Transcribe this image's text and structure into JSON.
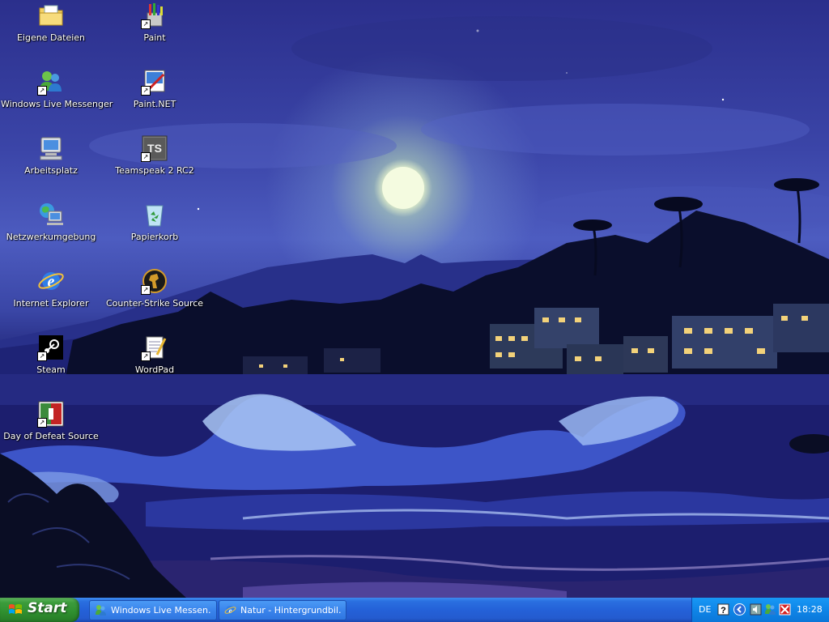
{
  "desktop": {
    "icons": [
      {
        "label": "Eigene Dateien",
        "icon": "folder-documents-icon"
      },
      {
        "label": "Windows Live Messenger",
        "icon": "messenger-icon"
      },
      {
        "label": "Arbeitsplatz",
        "icon": "my-computer-icon"
      },
      {
        "label": "Netzwerkumgebung",
        "icon": "network-icon"
      },
      {
        "label": "Internet Explorer",
        "icon": "internet-explorer-icon"
      },
      {
        "label": "Steam",
        "icon": "steam-icon"
      },
      {
        "label": "Day of Defeat Source",
        "icon": "day-of-defeat-icon"
      },
      {
        "label": "Paint",
        "icon": "paint-icon"
      },
      {
        "label": "Paint.NET",
        "icon": "paint-net-icon"
      },
      {
        "label": "Teamspeak 2 RC2",
        "icon": "teamspeak-icon"
      },
      {
        "label": "Papierkorb",
        "icon": "recycle-bin-icon"
      },
      {
        "label": "Counter-Strike Source",
        "icon": "counter-strike-icon"
      },
      {
        "label": "WordPad",
        "icon": "wordpad-icon"
      }
    ]
  },
  "taskbar": {
    "start_label": "Start",
    "tasks": [
      {
        "label": "Windows Live Messen...",
        "icon": "messenger-icon"
      },
      {
        "label": "Natur - Hintergrundbil...",
        "icon": "internet-explorer-icon"
      }
    ],
    "tray": {
      "language": "DE",
      "icons": [
        "help-icon",
        "chevron-left-icon",
        "volume-icon",
        "messenger-tray-icon",
        "antivirus-icon"
      ],
      "clock": "18:28"
    }
  },
  "colors": {
    "taskbar_blue": "#245bcf",
    "start_green": "#3c9c3c",
    "tray_blue": "#0f86e8",
    "wallpaper_night_blue": "#2b2f8c"
  }
}
